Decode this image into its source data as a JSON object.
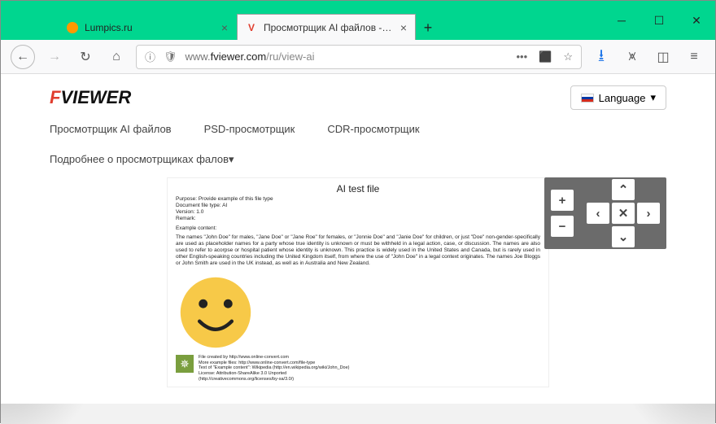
{
  "tabs": [
    {
      "title": "Lumpics.ru",
      "active": false
    },
    {
      "title": "Просмотрщик AI файлов -- О...",
      "active": true,
      "favicon": "V"
    }
  ],
  "url": {
    "prefix": "www.",
    "domain": "fviewer.com",
    "path": "/ru/view-ai"
  },
  "logo": {
    "f": "F",
    "rest": "VIEWER"
  },
  "lang": {
    "label": "Language",
    "caret": "▾"
  },
  "nav": {
    "ai": "Просмотрщик AI файлов",
    "psd": "PSD-просмотрщик",
    "cdr": "CDR-просмотрщик",
    "more": "Подробнее о просмотрщиках фалов▾"
  },
  "doc": {
    "title": "AI test file",
    "meta": "Purpose: Provide example of this file type\nDocument file type: AI\nVersion: 1.0\nRemark:",
    "example_label": "Example content:",
    "paragraph": "The names \"John Doe\" for males, \"Jane Doe\" or \"Jane Roe\" for females, or \"Jonnie Doe\" and \"Janie Doe\" for children, or just \"Doe\" non-gender-specifically are used as placeholder names for a party whose true identity is unknown or must be withheld in a legal action, case, or discussion. The names are also used to refer to acorpse or hospital patient whose identity is unknown. This practice is widely used in the United States and Canada, but is rarely used in other English-speaking countries including the United Kingdom itself, from where the use of \"John Doe\" in a legal context originates. The names Joe Bloggs or John Smith are used in the UK instead, as well as in Australia and New Zealand.",
    "footer": "File created by http://www.online-convert.com\nMore example files: http://www.online-convert.com/file-type\nText of \"Example content\": Wikipedia (http://en.wikipedia.org/wiki/John_Doe)\nLicense: Attribution-ShareAlike 3.0 Unported\n(http://creativecommons.org/licenses/by-sa/3.0/)"
  },
  "panel": {
    "zoom_in": "+",
    "zoom_out": "−",
    "up": "⌃",
    "left": "‹",
    "center": "✕",
    "right": "›",
    "down": "⌄"
  }
}
